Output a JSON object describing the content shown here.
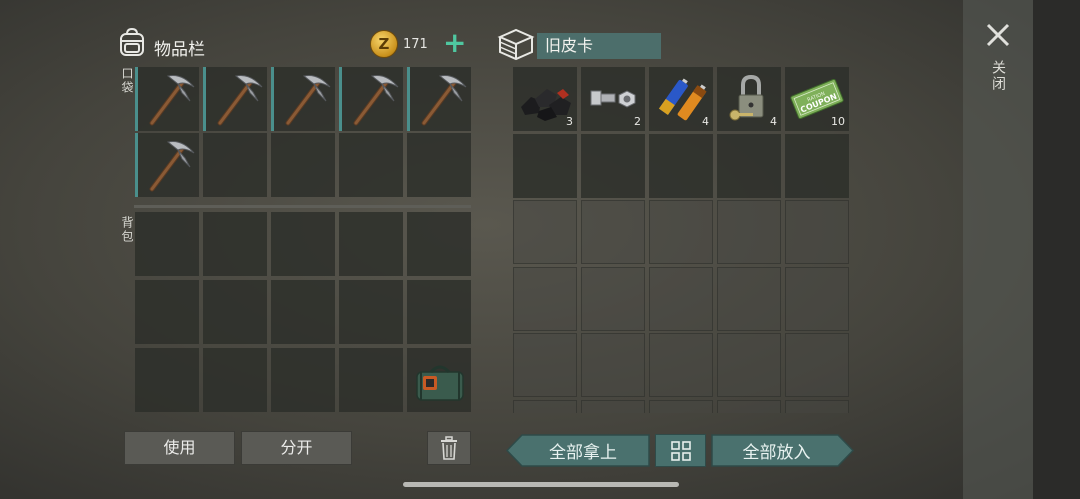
{
  "inventory": {
    "title": "物品栏",
    "coins": "171",
    "coin_symbol": "Z",
    "plus_icon": "plus-icon",
    "pocket_label": "口袋",
    "backpack_label": "背包",
    "pocket_items": [
      "pickaxe",
      "pickaxe",
      "pickaxe",
      "pickaxe",
      "pickaxe",
      "pickaxe"
    ],
    "backpack_items": [
      "green-supply-bag"
    ]
  },
  "container": {
    "title": "旧皮卡",
    "items": [
      {
        "icon": "coal-icon",
        "qty": "3"
      },
      {
        "icon": "bolt-nut-icon",
        "qty": "2"
      },
      {
        "icon": "batteries-icon",
        "qty": "4"
      },
      {
        "icon": "padlock-key-icon",
        "qty": "4"
      },
      {
        "icon": "ration-coupon-icon",
        "qty": "10"
      }
    ],
    "coupon_text": "RATION COUPON"
  },
  "close_label": "关闭",
  "buttons": {
    "use": "使用",
    "split": "分开",
    "take_all": "全部拿上",
    "put_all": "全部放入"
  },
  "colors": {
    "accent": "#4c6e6b",
    "plus": "#4fc7a0",
    "coin": "#e0ac35"
  }
}
